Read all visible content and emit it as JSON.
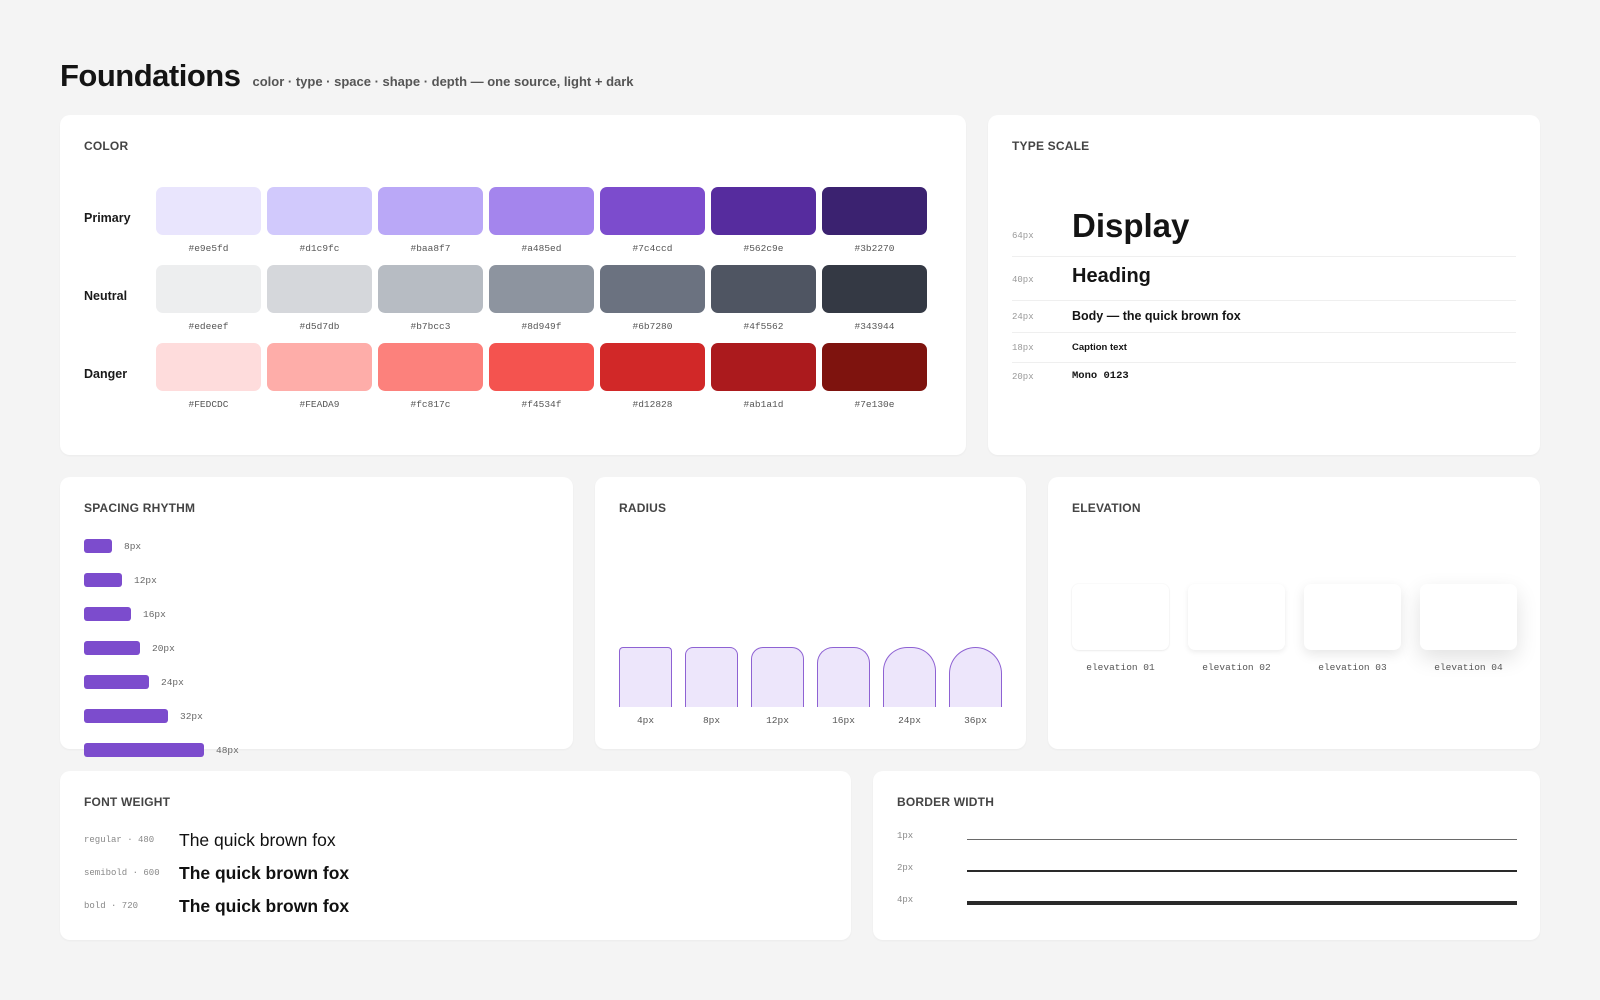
{
  "header": {
    "title": "Foundations",
    "subtitle": "color · type · space · shape · depth — one source, light + dark"
  },
  "color": {
    "title": "COLOR",
    "rows": [
      {
        "label": "Primary",
        "swatches": [
          {
            "hex": "#e9e5fd",
            "color": "#e9e5fd"
          },
          {
            "hex": "#d1c9fc",
            "color": "#d1c9fc"
          },
          {
            "hex": "#baa8f7",
            "color": "#baa8f7"
          },
          {
            "hex": "#a485ed",
            "color": "#a485ed"
          },
          {
            "hex": "#7c4ccd",
            "color": "#7c4ccd"
          },
          {
            "hex": "#562c9e",
            "color": "#562c9e"
          },
          {
            "hex": "#3b2270",
            "color": "#3b2270"
          }
        ]
      },
      {
        "label": "Neutral",
        "swatches": [
          {
            "hex": "#edeeef",
            "color": "#edeeef"
          },
          {
            "hex": "#d5d7db",
            "color": "#d5d7db"
          },
          {
            "hex": "#b7bcc3",
            "color": "#b7bcc3"
          },
          {
            "hex": "#8d949f",
            "color": "#8d949f"
          },
          {
            "hex": "#6b7280",
            "color": "#6b7280"
          },
          {
            "hex": "#4f5562",
            "color": "#4f5562"
          },
          {
            "hex": "#343944",
            "color": "#343944"
          }
        ]
      },
      {
        "label": "Danger",
        "swatches": [
          {
            "hex": "#FEDCDC",
            "color": "#fedcdc"
          },
          {
            "hex": "#FEADA9",
            "color": "#feada9"
          },
          {
            "hex": "#fc817c",
            "color": "#fc817c"
          },
          {
            "hex": "#f4534f",
            "color": "#f4534f"
          },
          {
            "hex": "#d12828",
            "color": "#d12828"
          },
          {
            "hex": "#ab1a1d",
            "color": "#ab1a1d"
          },
          {
            "hex": "#7e130e",
            "color": "#7e130e"
          }
        ]
      }
    ]
  },
  "type_scale": {
    "title": "TYPE SCALE",
    "rows": [
      {
        "size": "64px",
        "sample": "Display"
      },
      {
        "size": "40px",
        "sample": "Heading"
      },
      {
        "size": "24px",
        "sample": "Body — the quick brown fox"
      },
      {
        "size": "18px",
        "sample": "Caption text"
      },
      {
        "size": "20px",
        "sample": "Mono 0123"
      }
    ]
  },
  "spacing": {
    "title": "SPACING RHYTHM",
    "accent": "#7c4ccd",
    "items": [
      {
        "label": "8px",
        "value": 8
      },
      {
        "label": "12px",
        "value": 12
      },
      {
        "label": "16px",
        "value": 16
      },
      {
        "label": "20px",
        "value": 20
      },
      {
        "label": "24px",
        "value": 24
      },
      {
        "label": "32px",
        "value": 32
      },
      {
        "label": "48px",
        "value": 48
      }
    ]
  },
  "radius": {
    "title": "RADIUS",
    "items": [
      {
        "label": "4px",
        "value": 4
      },
      {
        "label": "8px",
        "value": 8
      },
      {
        "label": "12px",
        "value": 12
      },
      {
        "label": "16px",
        "value": 16
      },
      {
        "label": "24px",
        "value": 24
      },
      {
        "label": "36px",
        "value": 36
      }
    ]
  },
  "elevation": {
    "title": "ELEVATION",
    "items": [
      {
        "label": "elevation 01",
        "level": 1
      },
      {
        "label": "elevation 02",
        "level": 2
      },
      {
        "label": "elevation 03",
        "level": 3
      },
      {
        "label": "elevation 04",
        "level": 4
      }
    ]
  },
  "font_weight": {
    "title": "FONT WEIGHT",
    "rows": [
      {
        "meta": "regular · 480",
        "sample": "The quick brown fox",
        "weight": 400
      },
      {
        "meta": "semibold · 600",
        "sample": "The quick brown fox",
        "weight": 700
      },
      {
        "meta": "bold · 720",
        "sample": "The quick brown fox",
        "weight": 700
      }
    ]
  },
  "border_width": {
    "title": "BORDER WIDTH",
    "rows": [
      {
        "label": "1px",
        "value": 1
      },
      {
        "label": "2px",
        "value": 2
      },
      {
        "label": "4px",
        "value": 4
      }
    ]
  }
}
